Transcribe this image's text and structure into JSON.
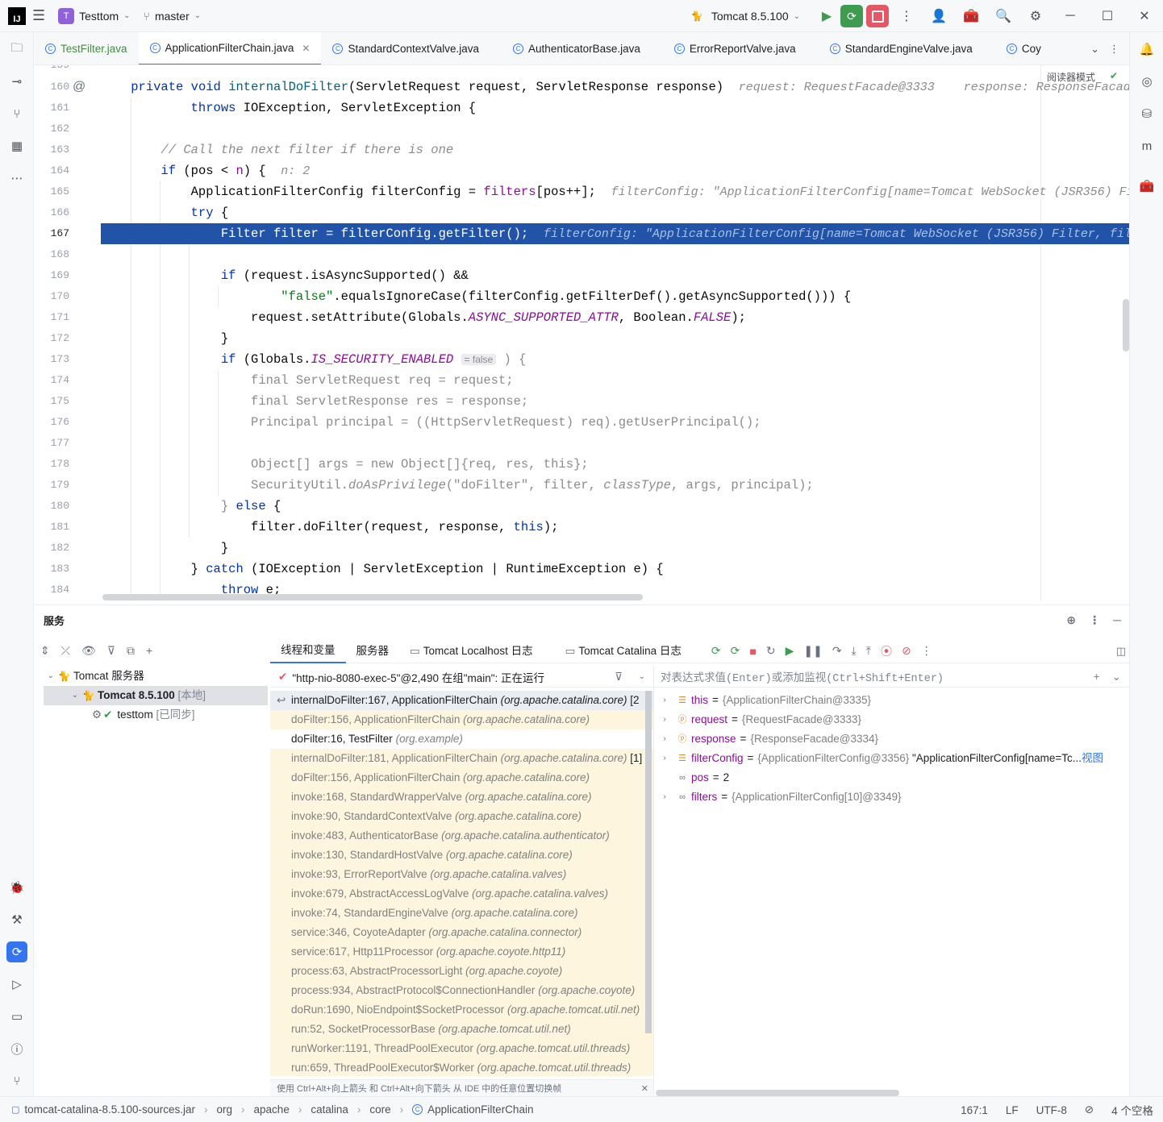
{
  "titlebar": {
    "project": "Testtom",
    "project_badge": "T",
    "branch": "master",
    "run_config": "Tomcat 8.5.100"
  },
  "tabs": [
    {
      "label": "TestFilter.java"
    },
    {
      "label": "ApplicationFilterChain.java"
    },
    {
      "label": "StandardContextValve.java"
    },
    {
      "label": "AuthenticatorBase.java"
    },
    {
      "label": "ErrorReportValve.java"
    },
    {
      "label": "StandardEngineValve.java"
    },
    {
      "label": "Coy"
    }
  ],
  "editor": {
    "reader_mode": "阅读器模式",
    "line_numbers": [
      "159",
      "160",
      "161",
      "162",
      "163",
      "164",
      "165",
      "166",
      "167",
      "168",
      "169",
      "170",
      "171",
      "172",
      "173",
      "174",
      "175",
      "176",
      "177",
      "178",
      "179",
      "180",
      "181",
      "182",
      "183",
      "184"
    ],
    "current_line": "167",
    "code": {
      "l160_a": "private",
      "l160_b": "void",
      "l160_fn": "internalDoFilter",
      "l160_c": "(ServletRequest request, ServletResponse response)",
      "l160_hint": "request: RequestFacade@3333    response: ResponseFacade@",
      "l161_kw": "throws",
      "l161": "IOException, ServletException {",
      "l163": "// Call the next filter if there is one",
      "l164_kw": "if",
      "l164_a": "(pos <",
      "l164_b": "n",
      "l164_c": ") {",
      "l164_hint": "n: 2",
      "l165_a": "ApplicationFilterConfig filterConfig =",
      "l165_f": "filters",
      "l165_b": "[pos++];",
      "l165_hint": "filterConfig: \"ApplicationFilterConfig[name=Tomcat WebSocket (JSR356) Fil",
      "l166_kw": "try",
      "l166": "{",
      "l167": "Filter filter = filterConfig.getFilter();",
      "l167_hint": "filterConfig: \"ApplicationFilterConfig[name=Tomcat WebSocket (JSR356) Filter, filt",
      "l169_kw": "if",
      "l169": "(request.isAsyncSupported() &&",
      "l170_str": "\"false\"",
      "l170": ".equalsIgnoreCase(filterConfig.getFilterDef().getAsyncSupported())) {",
      "l171_a": "request.setAttribute(Globals.",
      "l171_s": "ASYNC_SUPPORTED_ATTR",
      "l171_b": ", Boolean.",
      "l171_s2": "FALSE",
      "l171_c": ");",
      "l172": "}",
      "l173_kw": "if",
      "l173_a": "(Globals.",
      "l173_s": "IS_SECURITY_ENABLED",
      "l173_inlay": "= false",
      "l173_b": ") {",
      "l174": "final ServletRequest req = request;",
      "l175": "final ServletResponse res = response;",
      "l176": "Principal principal = ((HttpServletRequest) req).getUserPrincipal();",
      "l178": "Object[] args = new Object[]{req, res, this};",
      "l179_a": "SecurityUtil.",
      "l179_it": "doAsPrivilege",
      "l179_b": "(\"doFilter\", filter,",
      "l179_it2": "classType",
      "l179_c": ", args, principal);",
      "l180_a": "}",
      "l180_kw": "else",
      "l180_b": "{",
      "l181_a": "filter.doFilter(request, response,",
      "l181_kw": "this",
      "l181_b": ");",
      "l182": "}",
      "l183_a": "}",
      "l183_kw": "catch",
      "l183_b": "(IOException | ServletException | RuntimeException e) {",
      "l184_kw": "throw",
      "l184": "e;"
    }
  },
  "services": {
    "title": "服务",
    "tree": {
      "root": "Tomcat 服务器",
      "server": "Tomcat 8.5.100",
      "server_tag": "[本地]",
      "artifact": "testtom",
      "artifact_tag": "[已同步]"
    },
    "debug_tabs": [
      "线程和变量",
      "服务器",
      "Tomcat Localhost 日志",
      "Tomcat Catalina 日志"
    ],
    "thread": "\"http-nio-8080-exec-5\"@2,490 在组\"main\": 正在运行",
    "frames": [
      {
        "m": "internalDoFilter:167, ApplicationFilterChain",
        "p": "(org.apache.catalina.core)",
        "s": "[2"
      },
      {
        "m": "doFilter:156, ApplicationFilterChain",
        "p": "(org.apache.catalina.core)",
        "s": ""
      },
      {
        "m": "doFilter:16, TestFilter",
        "p": "(org.example)",
        "s": ""
      },
      {
        "m": "internalDoFilter:181, ApplicationFilterChain",
        "p": "(org.apache.catalina.core)",
        "s": "[1]"
      },
      {
        "m": "doFilter:156, ApplicationFilterChain",
        "p": "(org.apache.catalina.core)",
        "s": ""
      },
      {
        "m": "invoke:168, StandardWrapperValve",
        "p": "(org.apache.catalina.core)",
        "s": ""
      },
      {
        "m": "invoke:90, StandardContextValve",
        "p": "(org.apache.catalina.core)",
        "s": ""
      },
      {
        "m": "invoke:483, AuthenticatorBase",
        "p": "(org.apache.catalina.authenticator)",
        "s": ""
      },
      {
        "m": "invoke:130, StandardHostValve",
        "p": "(org.apache.catalina.core)",
        "s": ""
      },
      {
        "m": "invoke:93, ErrorReportValve",
        "p": "(org.apache.catalina.valves)",
        "s": ""
      },
      {
        "m": "invoke:679, AbstractAccessLogValve",
        "p": "(org.apache.catalina.valves)",
        "s": ""
      },
      {
        "m": "invoke:74, StandardEngineValve",
        "p": "(org.apache.catalina.core)",
        "s": ""
      },
      {
        "m": "service:346, CoyoteAdapter",
        "p": "(org.apache.catalina.connector)",
        "s": ""
      },
      {
        "m": "service:617, Http11Processor",
        "p": "(org.apache.coyote.http11)",
        "s": ""
      },
      {
        "m": "process:63, AbstractProcessorLight",
        "p": "(org.apache.coyote)",
        "s": ""
      },
      {
        "m": "process:934, AbstractProtocol$ConnectionHandler",
        "p": "(org.apache.coyote)",
        "s": ""
      },
      {
        "m": "doRun:1690, NioEndpoint$SocketProcessor",
        "p": "(org.apache.tomcat.util.net)",
        "s": ""
      },
      {
        "m": "run:52, SocketProcessorBase",
        "p": "(org.apache.tomcat.util.net)",
        "s": ""
      },
      {
        "m": "runWorker:1191, ThreadPoolExecutor",
        "p": "(org.apache.tomcat.util.threads)",
        "s": ""
      },
      {
        "m": "run:659, ThreadPoolExecutor$Worker",
        "p": "(org.apache.tomcat.util.threads)",
        "s": ""
      }
    ],
    "frames_hint": "使用 Ctrl+Alt+向上箭头 和 Ctrl+Alt+向下箭头 从 IDE 中的任意位置切换帧",
    "eval_placeholder": "对表达式求值(Enter)或添加监视(Ctrl+Shift+Enter)",
    "variables": [
      {
        "name": "this",
        "value": "{ApplicationFilterChain@3335}",
        "extra": "",
        "link": ""
      },
      {
        "name": "request",
        "value": "{RequestFacade@3333}",
        "extra": "",
        "link": ""
      },
      {
        "name": "response",
        "value": "{ResponseFacade@3334}",
        "extra": "",
        "link": ""
      },
      {
        "name": "filterConfig",
        "value": "{ApplicationFilterConfig@3356}",
        "extra": "\"ApplicationFilterConfig[name=Tc...",
        "link": "视图"
      },
      {
        "name": "pos",
        "value": "2",
        "extra": "",
        "link": ""
      },
      {
        "name": "filters",
        "value": "{ApplicationFilterConfig[10]@3349}",
        "extra": "",
        "link": ""
      }
    ]
  },
  "statusbar": {
    "crumbs": [
      "tomcat-catalina-8.5.100-sources.jar",
      "org",
      "apache",
      "catalina",
      "core",
      "ApplicationFilterChain"
    ],
    "position": "167:1",
    "line_sep": "LF",
    "encoding": "UTF-8",
    "indent": "4 个空格"
  }
}
